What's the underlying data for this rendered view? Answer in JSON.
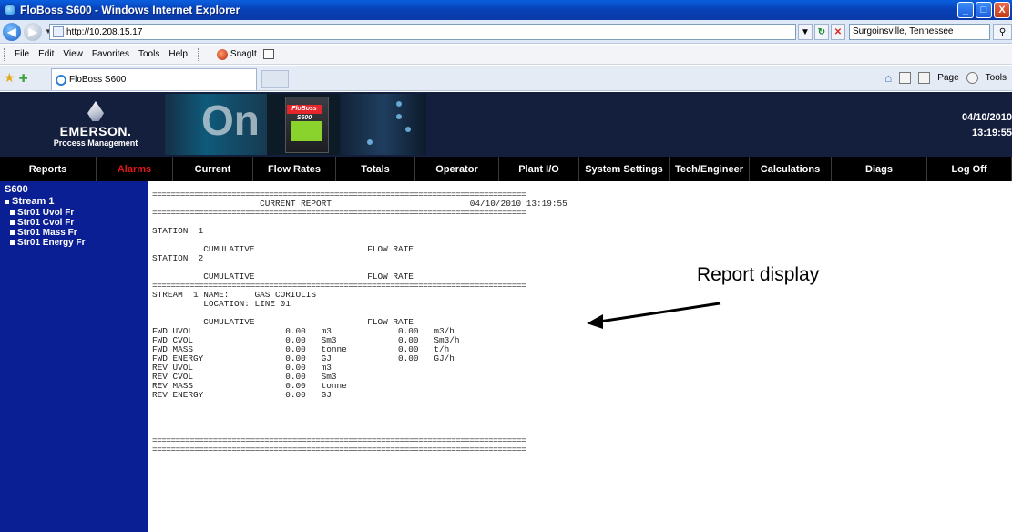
{
  "window": {
    "title": "FloBoss S600 - Windows Internet Explorer",
    "minimize": "_",
    "maximize": "□",
    "close": "X"
  },
  "address": {
    "url": "http://10.208.15.17",
    "search_value": "Surgoinsville, Tennessee"
  },
  "menu": {
    "items": [
      "File",
      "Edit",
      "View",
      "Favorites",
      "Tools",
      "Help"
    ],
    "snagit": "SnagIt"
  },
  "tab": {
    "title": "FloBoss S600"
  },
  "commandbar": {
    "page": "Page",
    "tools": "Tools"
  },
  "header": {
    "brand": "EMERSON.",
    "sub": "Process Management",
    "device_badge": "FloBoss S600",
    "date": "04/10/2010",
    "time": "13:19:55"
  },
  "nav": {
    "items": [
      "Reports",
      "Alarms",
      "Current",
      "Flow Rates",
      "Totals",
      "Operator",
      "Plant I/O",
      "System Settings",
      "Tech/Engineer",
      "Calculations",
      "Diags",
      "Log Off"
    ]
  },
  "sidebar": {
    "root": "S600",
    "stream": "Stream 1",
    "items": [
      "Str01 Uvol Fr",
      "Str01 Cvol Fr",
      "Str01 Mass Fr",
      "Str01 Energy Fr"
    ]
  },
  "report": {
    "lines": [
      "================================================================================",
      "                     CURRENT REPORT                           04/10/2010 13:19:55",
      "================================================================================",
      "",
      "STATION  1",
      "",
      "          CUMULATIVE                      FLOW RATE",
      "STATION  2",
      "",
      "          CUMULATIVE                      FLOW RATE",
      "================================================================================",
      "STREAM  1 NAME:     GAS CORIOLIS",
      "          LOCATION: LINE 01",
      "",
      "          CUMULATIVE                      FLOW RATE",
      "FWD UVOL                  0.00   m3             0.00   m3/h",
      "FWD CVOL                  0.00   Sm3            0.00   Sm3/h",
      "FWD MASS                  0.00   tonne          0.00   t/h",
      "FWD ENERGY                0.00   GJ             0.00   GJ/h",
      "REV UVOL                  0.00   m3",
      "REV CVOL                  0.00   Sm3",
      "REV MASS                  0.00   tonne",
      "REV ENERGY                0.00   GJ",
      "",
      "",
      "",
      "",
      "================================================================================",
      "================================================================================"
    ]
  },
  "annotation": {
    "label": "Report display"
  }
}
